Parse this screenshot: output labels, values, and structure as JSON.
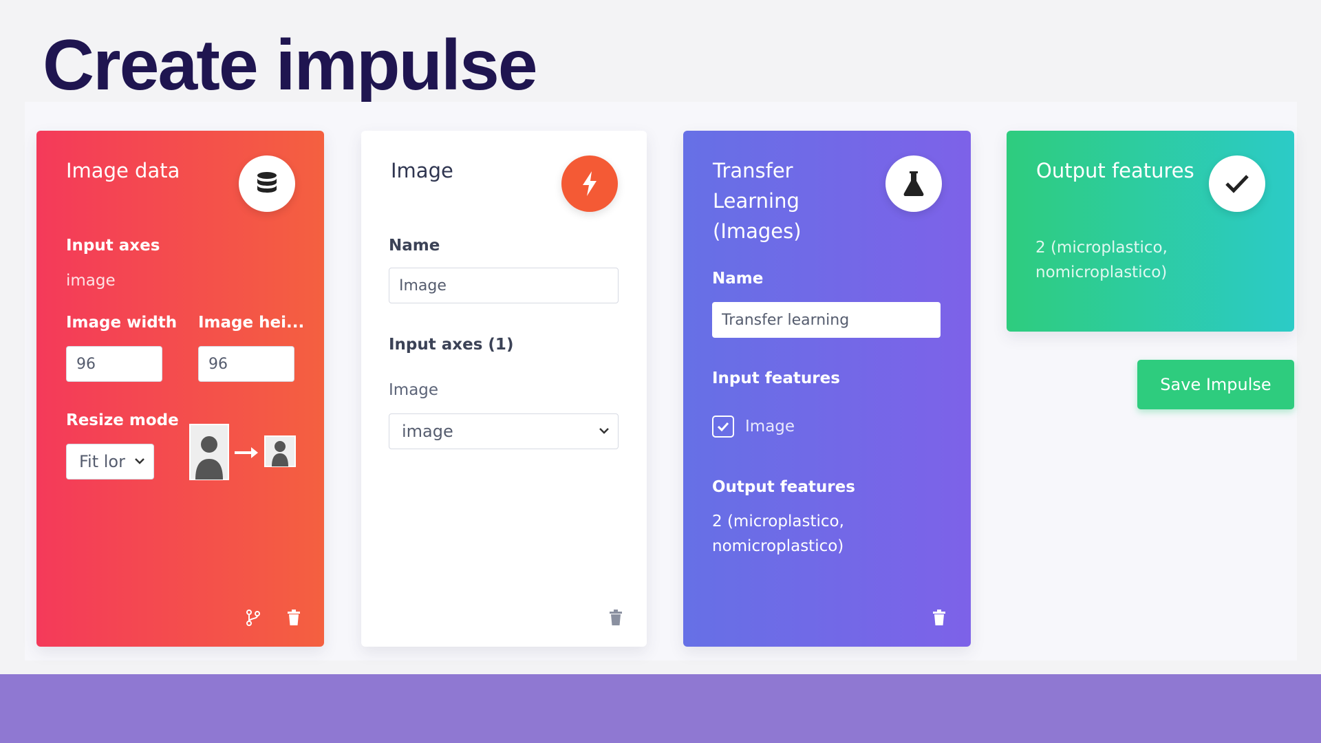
{
  "page": {
    "title": "Create impulse"
  },
  "input_block": {
    "title": "Image data",
    "icon": "database-icon",
    "input_axes_label": "Input axes",
    "input_axes_value": "image",
    "width_label": "Image width",
    "width_value": "96",
    "height_label": "Image hei...",
    "height_value": "96",
    "resize_label": "Resize mode",
    "resize_value": "Fit lor"
  },
  "processing_block": {
    "title": "Image",
    "icon": "lightning-icon",
    "name_label": "Name",
    "name_value": "Image",
    "axes_label": "Input axes (1)",
    "axis_item_label": "Image",
    "axis_select_value": "image"
  },
  "learning_block": {
    "title": "Transfer Learning (Images)",
    "icon": "flask-icon",
    "name_label": "Name",
    "name_value": "Transfer learning",
    "input_features_label": "Input features",
    "feature_checkbox_label": "Image",
    "output_features_label": "Output features",
    "output_features_line1": "2 (microplastico,",
    "output_features_line2": "nomicroplastico)"
  },
  "output_block": {
    "title": "Output features",
    "icon": "check-icon",
    "line1": "2 (microplastico,",
    "line2": "nomicroplastico)"
  },
  "actions": {
    "save_label": "Save Impulse"
  },
  "colors": {
    "title": "#1f1550",
    "input_block": "#f4465a",
    "processing_badge": "#f45a35",
    "learning_block": "#7168e7",
    "output_block": "#2ecc9a",
    "save_button": "#2ecc7e",
    "bottom_band": "#8f78d2"
  }
}
